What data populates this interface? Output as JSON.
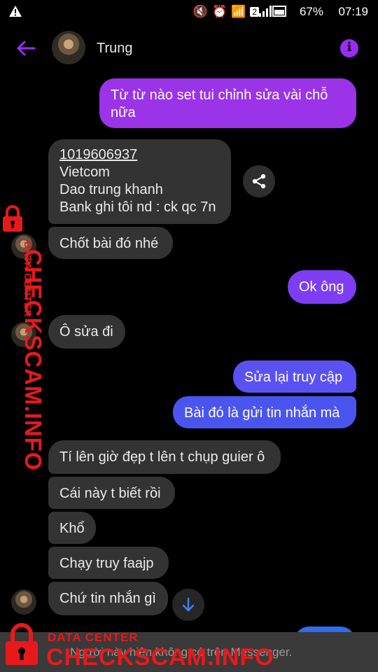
{
  "status_bar": {
    "battery": "67%",
    "time": "07:19",
    "sim_badge": "2"
  },
  "header": {
    "contact_name": "Trung"
  },
  "messages": [
    {
      "direction": "outgoing",
      "text": "Từ từ nào set tui chỉnh sửa vài chỗ nữa"
    },
    {
      "direction": "incoming",
      "lines": [
        "1019606937",
        "Vietcom",
        "Dao trung khanh",
        "Bank ghi tôi nd : ck qc 7n"
      ]
    },
    {
      "direction": "incoming",
      "text": "Chốt bài đó nhé"
    },
    {
      "direction": "outgoing",
      "text": "Ok ông"
    },
    {
      "direction": "incoming",
      "text": "Ô sửa đi"
    },
    {
      "direction": "outgoing",
      "text": "Sửa lại truy cập"
    },
    {
      "direction": "outgoing",
      "text": "Bài đó là gửi tin nhắn mà"
    },
    {
      "direction": "incoming",
      "text": "Tí lên giờ đẹp t lên t chụp guier ô"
    },
    {
      "direction": "incoming",
      "text": "Cái này t biết rồi"
    },
    {
      "direction": "incoming",
      "text": "Khổ"
    },
    {
      "direction": "incoming",
      "text": "Chạy truy faajp"
    },
    {
      "direction": "incoming",
      "text": "Chứ tin nhắn gì"
    }
  ],
  "footer": {
    "notice": "Người này hiện không có trên Messenger."
  },
  "watermark": {
    "label_top": "DATA CENTER",
    "label_main": "CHECKSCAM.INFO"
  },
  "colors": {
    "accent": "#9b2cf7",
    "incoming_bubble": "#333333",
    "watermark": "#e8191b"
  }
}
